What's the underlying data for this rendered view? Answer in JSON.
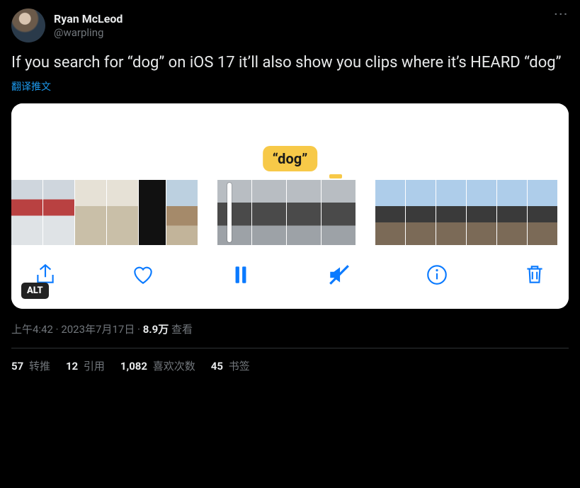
{
  "author": {
    "display_name": "Ryan McLeod",
    "handle": "@warpling"
  },
  "tweet_text": "If you search for “dog” on iOS 17 it’ll also show you clips where it’s HEARD “dog”",
  "translate_label": "翻译推文",
  "media": {
    "highlight_tag": "“dog”",
    "alt_badge": "ALT",
    "toolbar": {
      "share": "share",
      "like": "like",
      "pause": "pause",
      "mute": "mute",
      "info": "info",
      "trash": "trash"
    }
  },
  "meta": {
    "time": "上午4:42",
    "sep1": " · ",
    "date": "2023年7月17日",
    "sep2": " · ",
    "views_count": "8.9万",
    "views_label": " 查看"
  },
  "stats": {
    "retweets": {
      "count": "57",
      "label": " 转推"
    },
    "quotes": {
      "count": "12",
      "label": " 引用"
    },
    "likes": {
      "count": "1,082",
      "label": " 喜欢次数"
    },
    "bookmarks": {
      "count": "45",
      "label": " 书签"
    }
  }
}
